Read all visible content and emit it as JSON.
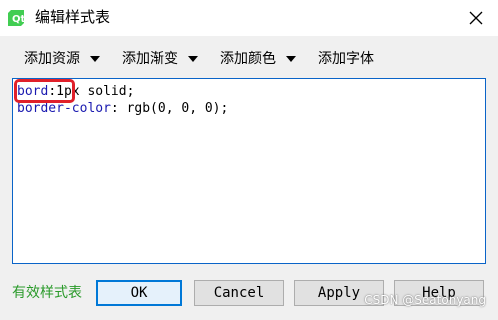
{
  "window": {
    "title": "编辑样式表",
    "icon": "qt-icon",
    "close_icon": "close-icon"
  },
  "toolbar": {
    "items": [
      {
        "label": "添加资源",
        "icon": "chevron-down-icon"
      },
      {
        "label": "添加渐变",
        "icon": "chevron-down-icon"
      },
      {
        "label": "添加颜色",
        "icon": "chevron-down-icon"
      },
      {
        "label": "添加字体"
      }
    ]
  },
  "editor": {
    "lines": [
      {
        "property": "bord",
        "rest": ":1px solid;"
      },
      {
        "property": "border-color",
        "rest": ": rgb(0, 0, 0);"
      }
    ],
    "highlight_color": "#e0202a"
  },
  "status": {
    "text": "有效样式表",
    "color": "#2a9a2a"
  },
  "buttons": {
    "ok": "OK",
    "cancel": "Cancel",
    "apply": "Apply",
    "help": "Help"
  },
  "watermark": "CSDN @Seatonyang"
}
